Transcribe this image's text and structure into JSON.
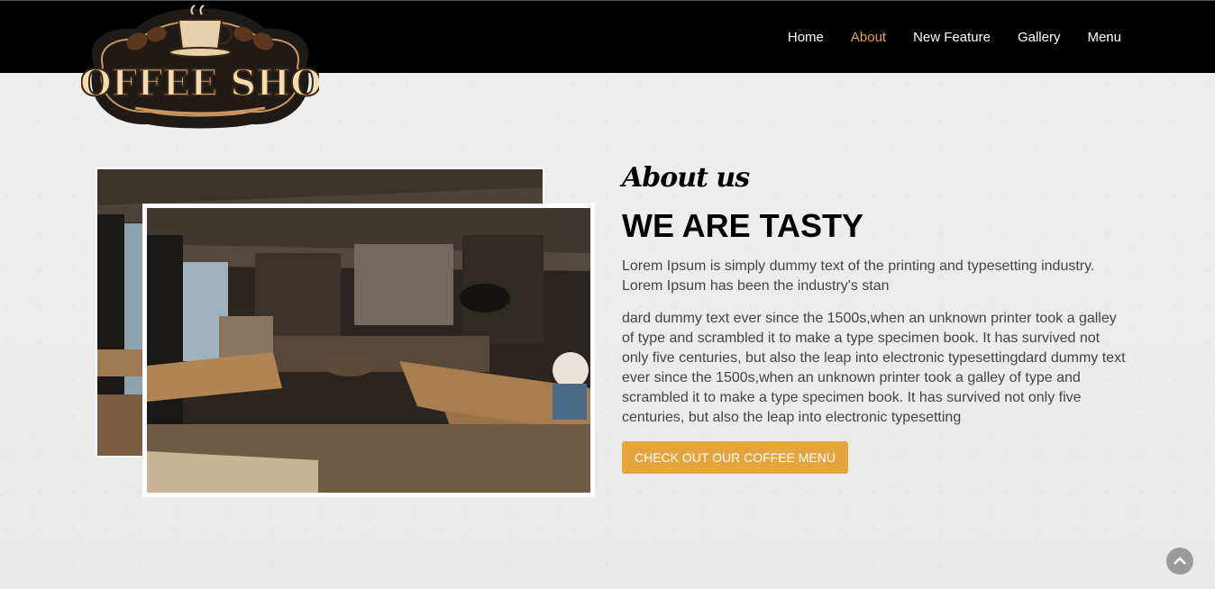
{
  "nav": {
    "items": [
      {
        "label": "Home",
        "active": false
      },
      {
        "label": "About",
        "active": true
      },
      {
        "label": "New Feature",
        "active": false
      },
      {
        "label": "Gallery",
        "active": false
      },
      {
        "label": "Menu",
        "active": false
      }
    ]
  },
  "logo": {
    "text": "COFFEE SHOP",
    "icon": "coffee-cup-icon"
  },
  "about": {
    "eyebrow": "About us",
    "headline": "WE ARE TASTY",
    "paragraph1": "Lorem Ipsum is simply dummy text of the printing and typesetting industry. Lorem Ipsum has been the industry's stan",
    "paragraph2": "dard dummy text ever since the 1500s,when an unknown printer took a galley of type and scrambled it to make a type specimen book. It has survived not only five centuries, but also the leap into electronic typesettingdard dummy text ever since the 1500s,when an unknown printer took a galley of type and scrambled it to make a type specimen book. It has survived not only five centuries, but also the leap into electronic typesetting",
    "cta_label": "CHECK OUT OUR COFFEE MENU"
  },
  "scroll_top": {
    "icon": "chevron-up-icon"
  },
  "colors": {
    "accent": "#e6a43c",
    "navbar": "#000000"
  }
}
